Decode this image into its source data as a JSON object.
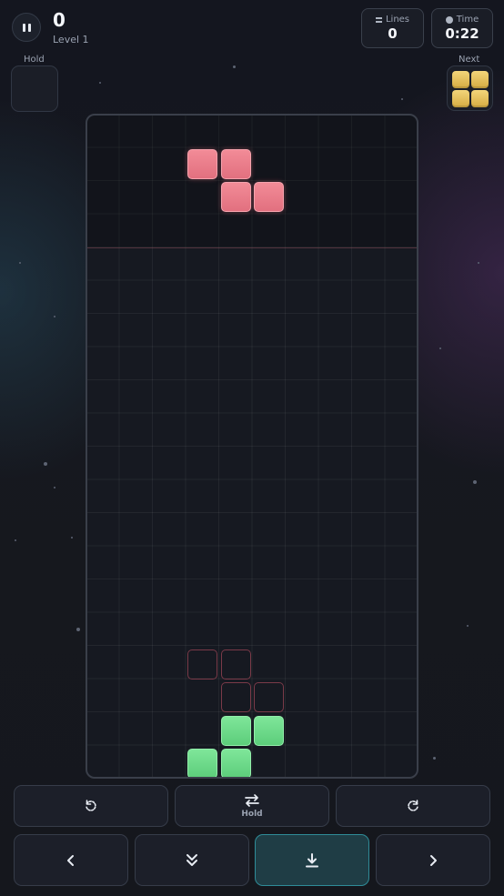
{
  "header": {
    "score": "0",
    "level": "Level 1",
    "lines_label": "Lines",
    "lines_value": "0",
    "time_label": "Time",
    "time_value": "0:22"
  },
  "hold": {
    "label": "Hold",
    "piece": null
  },
  "next": {
    "label": "Next",
    "piece": "O",
    "color": "#e9c25a"
  },
  "board": {
    "columns": 10,
    "rows": 20,
    "active_piece": {
      "type": "Z",
      "color": "#ef7f8c"
    },
    "ghost_piece": {
      "type": "Z",
      "color": "#7a3a48"
    },
    "locked_pieces": [
      {
        "type": "S",
        "color": "#6fdc8a"
      }
    ]
  },
  "controls": {
    "rotate_left_icon": "rotate-ccw-icon",
    "hold_label": "Hold",
    "rotate_right_icon": "rotate-cw-icon",
    "move_left_icon": "chevron-left-icon",
    "soft_drop_icon": "double-chevron-down-icon",
    "hard_drop_icon": "hard-drop-icon",
    "move_right_icon": "chevron-right-icon",
    "primary_color": "#2f8c98"
  }
}
